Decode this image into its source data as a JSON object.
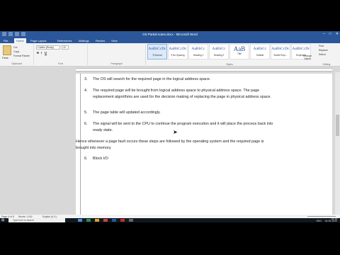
{
  "window": {
    "title": "OS Partial notes.docx - Microsoft Word"
  },
  "tabs": [
    "File",
    "Home",
    "Page Layout",
    "References",
    "Mailings",
    "Review",
    "View"
  ],
  "ribbon": {
    "clipboard": {
      "paste": "Paste",
      "cut": "Cut",
      "copy": "Copy",
      "format_painter": "Format Painter",
      "label": "Clipboard"
    },
    "font": {
      "name": "Calibri (Body)",
      "size": "11",
      "label": "Font"
    },
    "paragraph_label": "Paragraph",
    "styles": [
      {
        "sample": "AaBbCcDc",
        "name": "¶ Normal",
        "selected": true
      },
      {
        "sample": "AaBbCcDc",
        "name": "¶ No Spacing",
        "selected": false
      },
      {
        "sample": "AaBbCc",
        "name": "Heading 1",
        "selected": false
      },
      {
        "sample": "AaBbCc",
        "name": "Heading 2",
        "selected": false
      },
      {
        "sample": "AaB",
        "name": "Title",
        "selected": false
      },
      {
        "sample": "AaBbCc",
        "name": "Subtitle",
        "selected": false
      },
      {
        "sample": "AaBbCcDc",
        "name": "Subtle Emp...",
        "selected": false
      },
      {
        "sample": "AaBbCcDc",
        "name": "Emphasis",
        "selected": false
      }
    ],
    "styles_label": "Styles",
    "change_styles": "Change Styles",
    "editing": {
      "find": "Find",
      "replace": "Replace",
      "select": "Select",
      "label": "Editing"
    }
  },
  "document": {
    "items": [
      {
        "num": "3.",
        "text": "The OS will search for the required page in the logical address space."
      },
      {
        "num": "4.",
        "text": "The required page will be brought from logical address space to physical address space. The page replacement algorithms are used for the decision making of replacing the page in physical address space."
      },
      {
        "num": "5.",
        "text": "The page table will updated accordingly."
      },
      {
        "num": "6.",
        "text": "The signal will be sent to the CPU to continue the program execution and it will place the process back into ready state."
      }
    ],
    "paragraph": "Hence whenever a page fault occurs these steps are followed by the operating system and the required page is brought into memory.",
    "item6": {
      "num": "6.",
      "text": "Block I/O"
    }
  },
  "status": {
    "page": "Page: 6 of 8",
    "words": "Words: 1,042",
    "language": "English (U.S.)"
  },
  "taskbar": {
    "search": "Type here to search",
    "lang": "ENG",
    "time": "16:18",
    "date": "04-05-2020"
  }
}
